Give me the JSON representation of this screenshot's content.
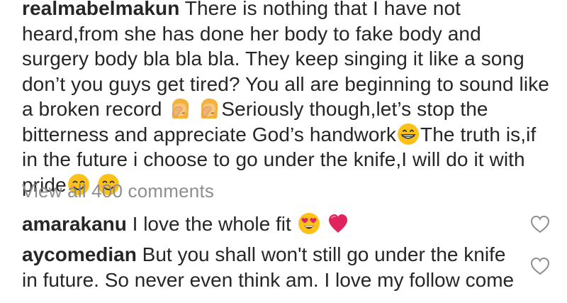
{
  "post": {
    "author": "realmabelmakun",
    "caption_parts": {
      "p1": " There is nothing that I have not heard,from she has done her body to fake body and surgery body bla bla bla. They keep singing it like a song don’t you guys get tired?  You all are beginning to sound like a broken record ",
      "p2": "Seriously though,let’s stop the bitterness and appreciate God’s handwork",
      "p3": "The truth is,if in the future i choose to go under the knife,I will do it with pride"
    }
  },
  "view_all_comments": "View all 400 comments",
  "comments": [
    {
      "username": "amarakanu",
      "text": " I love the whole fit "
    },
    {
      "username": "aycomedian",
      "text": " But you shall won't still go under the knife in future. So never even think am. I love my follow come"
    }
  ],
  "icons": {
    "facepalm": "woman-facepalming-icon",
    "grin": "grinning-face-icon",
    "smile": "smiling-face-icon",
    "heart_eyes": "heart-eyes-face-icon",
    "red_heart": "red-heart-icon",
    "like": "heart-outline-icon"
  },
  "colors": {
    "text": "#262626",
    "muted": "#8e8e8e",
    "heart_red": "#e0245e",
    "emoji_yellow": "#fcc21b"
  }
}
